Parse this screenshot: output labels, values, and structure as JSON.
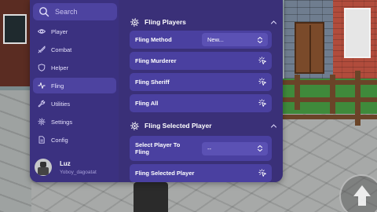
{
  "search": {
    "placeholder": "Search"
  },
  "sidebar": {
    "items": [
      {
        "label": "Player",
        "icon": "eye-icon"
      },
      {
        "label": "Combat",
        "icon": "sword-icon"
      },
      {
        "label": "Helper",
        "icon": "shield-icon"
      },
      {
        "label": "Fling",
        "icon": "activity-icon",
        "active": true
      },
      {
        "label": "Utilities",
        "icon": "wrench-icon"
      },
      {
        "label": "Settings",
        "icon": "gear-icon"
      },
      {
        "label": "Config",
        "icon": "file-icon"
      }
    ]
  },
  "profile": {
    "name": "Luz",
    "username": "Yoboy_dagoatat"
  },
  "sections": {
    "fling_players": {
      "title": "Fling Players",
      "method_label": "Fling Method",
      "method_value": "New...",
      "buttons": [
        "Fling Murderer",
        "Fling Sheriff",
        "Fling All"
      ]
    },
    "fling_selected": {
      "title": "Fling Selected Player",
      "select_label": "Select Player To Fling",
      "select_value": "--",
      "button": "Fling Selected Player"
    }
  },
  "colors": {
    "panel": "#3a3078",
    "card": "#4a40a0",
    "active_nav": "#4d43a0",
    "text": "#ffffff"
  }
}
